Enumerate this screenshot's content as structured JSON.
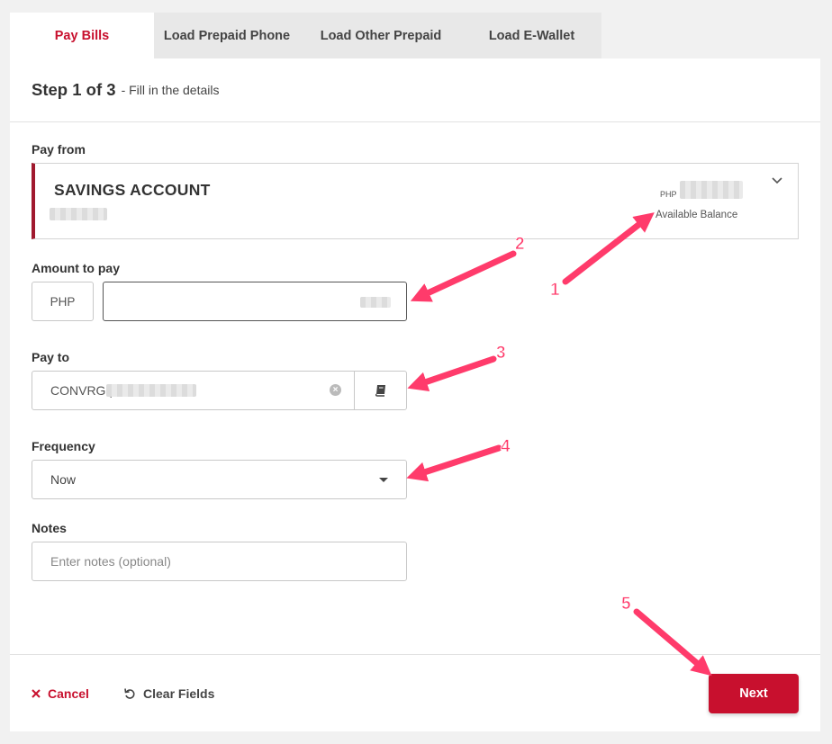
{
  "tabs": [
    {
      "label": "Pay Bills",
      "active": true
    },
    {
      "label": "Load Prepaid Phone",
      "active": false
    },
    {
      "label": "Load Other Prepaid",
      "active": false
    },
    {
      "label": "Load E-Wallet",
      "active": false
    }
  ],
  "step": {
    "title": "Step 1 of 3",
    "subtitle": "- Fill in the details"
  },
  "pay_from": {
    "label": "Pay from",
    "account_name": "SAVINGS ACCOUNT",
    "currency": "PHP",
    "balance_label": "Available Balance",
    "icon": "chevron-down-icon"
  },
  "amount": {
    "label": "Amount to pay",
    "currency": "PHP"
  },
  "pay_to": {
    "label": "Pay to",
    "biller": "CONVRG |",
    "icon": "address-book-icon"
  },
  "frequency": {
    "label": "Frequency",
    "value": "Now"
  },
  "notes": {
    "label": "Notes",
    "placeholder": "Enter notes (optional)"
  },
  "footer": {
    "cancel": "Cancel",
    "clear": "Clear Fields",
    "next": "Next"
  },
  "annotations": [
    "1",
    "2",
    "3",
    "4",
    "5"
  ],
  "colors": {
    "accent": "#c8102e",
    "account_bar": "#a0192e",
    "annotation": "#ff3b6b"
  }
}
